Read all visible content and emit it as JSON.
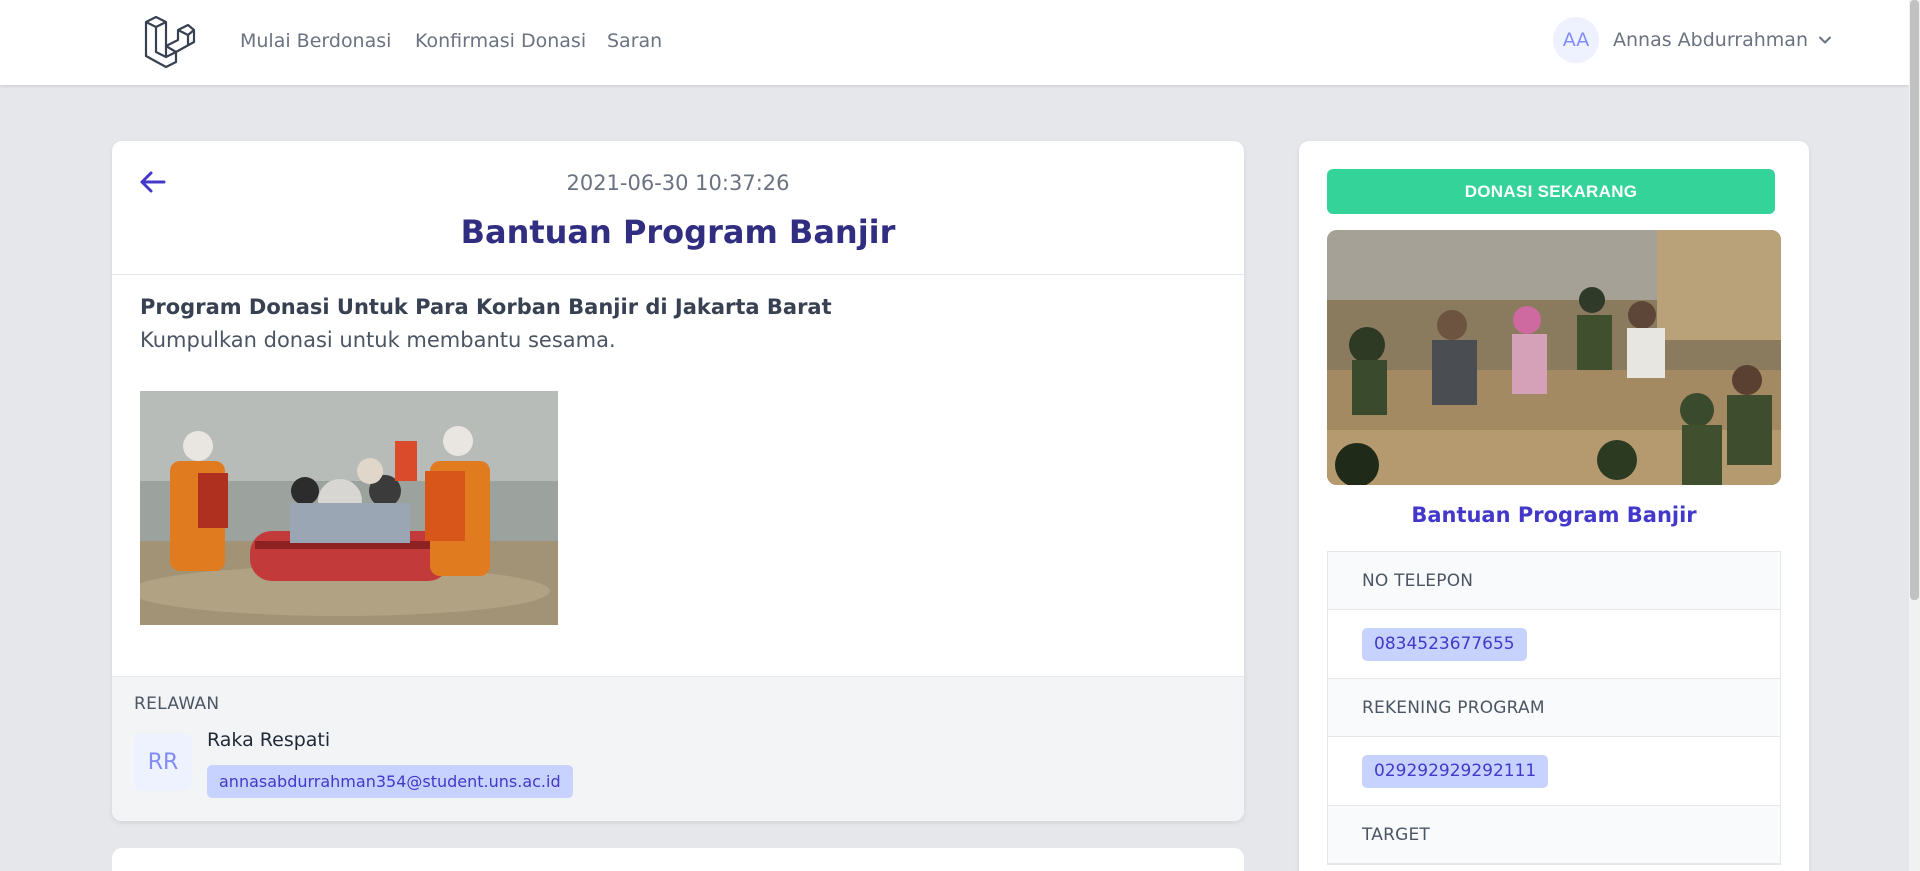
{
  "nav": {
    "links": [
      "Mulai Berdonasi",
      "Konfirmasi Donasi",
      "Saran"
    ],
    "user": {
      "initials": "AA",
      "name": "Annas Abdurrahman"
    }
  },
  "post": {
    "date": "2021-06-30 10:37:26",
    "title": "Bantuan Program Banjir",
    "subtitle": "Program Donasi Untuk Para Korban Banjir di Jakarta Barat",
    "description": "Kumpulkan donasi untuk membantu sesama."
  },
  "relawan": {
    "heading": "RELAWAN",
    "initials": "RR",
    "name": "Raka Respati",
    "email": "annasabdurrahman354@student.uns.ac.id"
  },
  "sidebar": {
    "donate_label": "DONASI SEKARANG",
    "title": "Bantuan Program Banjir",
    "info": [
      {
        "label": "NO TELEPON",
        "value": "0834523677655"
      },
      {
        "label": "REKENING PROGRAM",
        "value": "029292929292111"
      },
      {
        "label": "TARGET",
        "value": ""
      }
    ]
  },
  "colors": {
    "accent": "#4338ca",
    "title": "#312e81",
    "donate": "#34d399",
    "badge_bg": "#c7d2fe",
    "page_bg": "#e5e7eb"
  },
  "icons": {
    "logo": "laravel-logo-icon",
    "back": "arrow-left-icon",
    "dropdown": "chevron-down-icon"
  }
}
